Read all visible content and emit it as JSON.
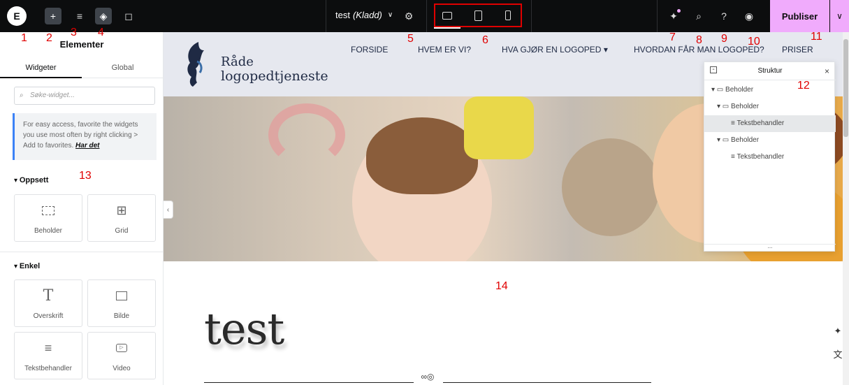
{
  "topbar": {
    "title": "test",
    "status": "(Kladd)",
    "publish_label": "Publiser"
  },
  "annotations": [
    "1",
    "2",
    "3",
    "4",
    "5",
    "6",
    "7",
    "8",
    "9",
    "10",
    "11",
    "12",
    "13",
    "14"
  ],
  "panel": {
    "title": "Elementer",
    "tabs": [
      "Widgeter",
      "Global"
    ],
    "search_placeholder": "Søke-widget...",
    "info_text": "For easy access, favorite the widgets you use most often by right clicking > Add to favorites.",
    "info_link": "Har det",
    "categories": [
      "Oppsett",
      "Enkel"
    ],
    "widgets": [
      "Beholder",
      "Grid",
      "Overskrift",
      "Bilde",
      "Tekstbehandler",
      "Video"
    ]
  },
  "site": {
    "brand_line1": "Råde",
    "brand_line2": "logopedtjeneste",
    "nav": [
      "FORSIDE",
      "HVEM ER VI?",
      "HVA GJØR EN LOGOPED",
      "HVORDAN FÅR MAN LOGOPED?",
      "PRISER"
    ],
    "heading": "test"
  },
  "structure": {
    "title": "Struktur",
    "nodes": [
      "Beholder",
      "Beholder",
      "Tekstbehandler",
      "Beholder",
      "Tekstbehandler"
    ],
    "footer": "..."
  },
  "colors": {
    "publish": "#f0abfc",
    "topbar": "#0c0d0e",
    "annotation": "#e00000"
  }
}
